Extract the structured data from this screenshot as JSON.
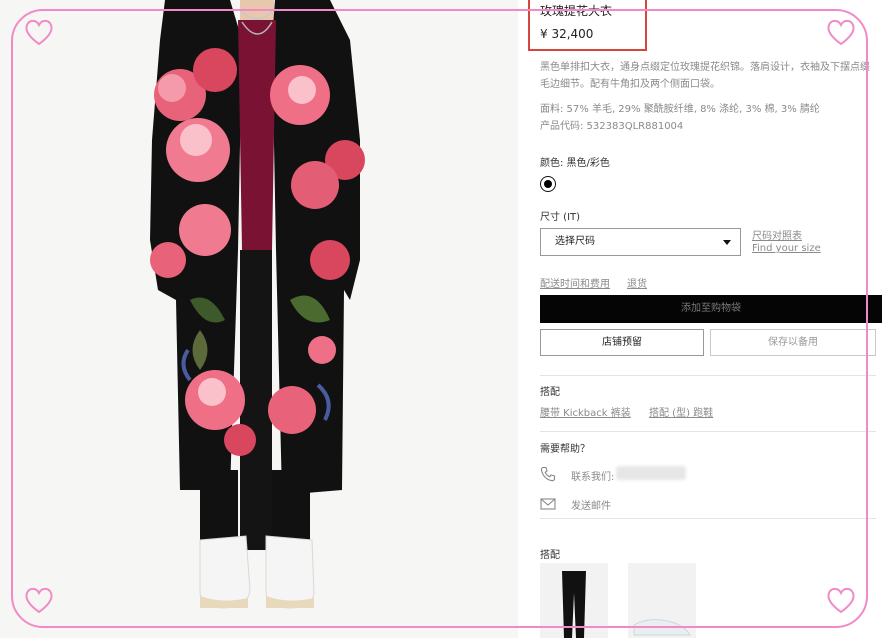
{
  "product": {
    "title": "玫瑰提花大衣",
    "price": "¥ 32,400",
    "description": "黑色单排扣大衣，通身点缀定位玫瑰提花织锦。落肩设计，衣袖及下摆点缀毛边细节。配有牛角扣及两个侧面口袋。",
    "fabric": "面料: 57% 羊毛, 29% 聚酰胺纤维, 8% 涤纶, 3% 棉, 3% 腈纶",
    "code": "产品代码: 532383QLR881004"
  },
  "color": {
    "label": "颜色: 黑色/彩色",
    "swatch": "#000000"
  },
  "size": {
    "label": "尺寸 (IT)",
    "select_value": "选择尺码",
    "guide_cn": "尺码对照表",
    "guide_en": "Find your size"
  },
  "shipping": {
    "delivery_link": "配送时间和费用",
    "returns_link": "退货"
  },
  "actions": {
    "add_to_bag": "添加至购物袋",
    "store_reserve": "店铺预留",
    "save_for_later": "保存以备用"
  },
  "pairing": {
    "heading": "搭配",
    "links": [
      "腰带 Kickback 裤装",
      "搭配 (型) 跑鞋"
    ]
  },
  "help": {
    "heading": "需要帮助？",
    "contact": "联系我们:",
    "email": "发送邮件"
  },
  "pairing2": {
    "heading": "搭配"
  },
  "colors": {
    "frame": "#f08bc5",
    "title_box": "#d6463c",
    "button_black": "#050505"
  }
}
